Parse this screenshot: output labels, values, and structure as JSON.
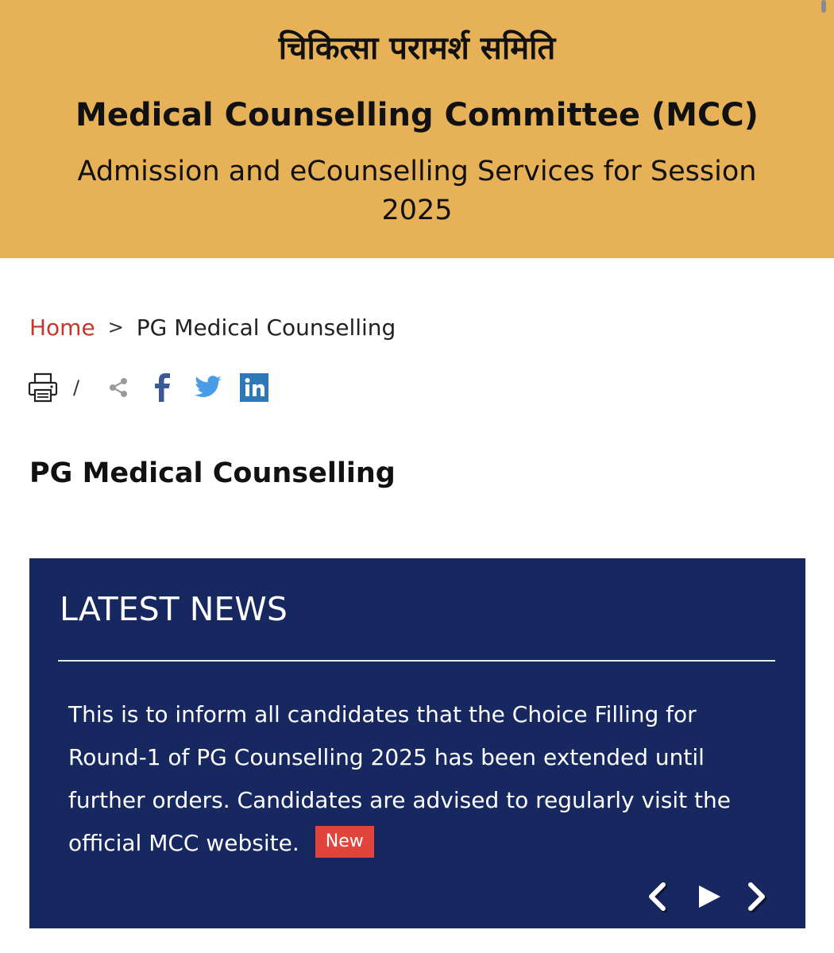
{
  "header": {
    "hindi_title": "चिकित्सा परामर्श समिति",
    "title": "Medical Counselling Committee (MCC)",
    "subtitle": "Admission and eCounselling Services for Session 2025",
    "background_color": "#e6b157"
  },
  "breadcrumb": {
    "home_label": "Home",
    "separator": ">",
    "current_label": "PG Medical Counselling",
    "home_color": "#c0392b"
  },
  "share_bar": {
    "separator": "/",
    "icons": [
      "print-icon",
      "share-icon",
      "facebook-icon",
      "twitter-icon",
      "linkedin-icon"
    ]
  },
  "page": {
    "title": "PG Medical Counselling"
  },
  "latest_news": {
    "heading": "LATEST NEWS",
    "text": "This is to inform all candidates that the Choice Filling for Round-1 of PG Counselling 2025 has been extended until further orders. Candidates are advised to regularly visit the official MCC website.",
    "badge": "New",
    "background_color": "#16285f",
    "badge_color": "#e0443a",
    "controls": [
      "chevron-left-icon",
      "play-icon",
      "chevron-right-icon"
    ]
  }
}
